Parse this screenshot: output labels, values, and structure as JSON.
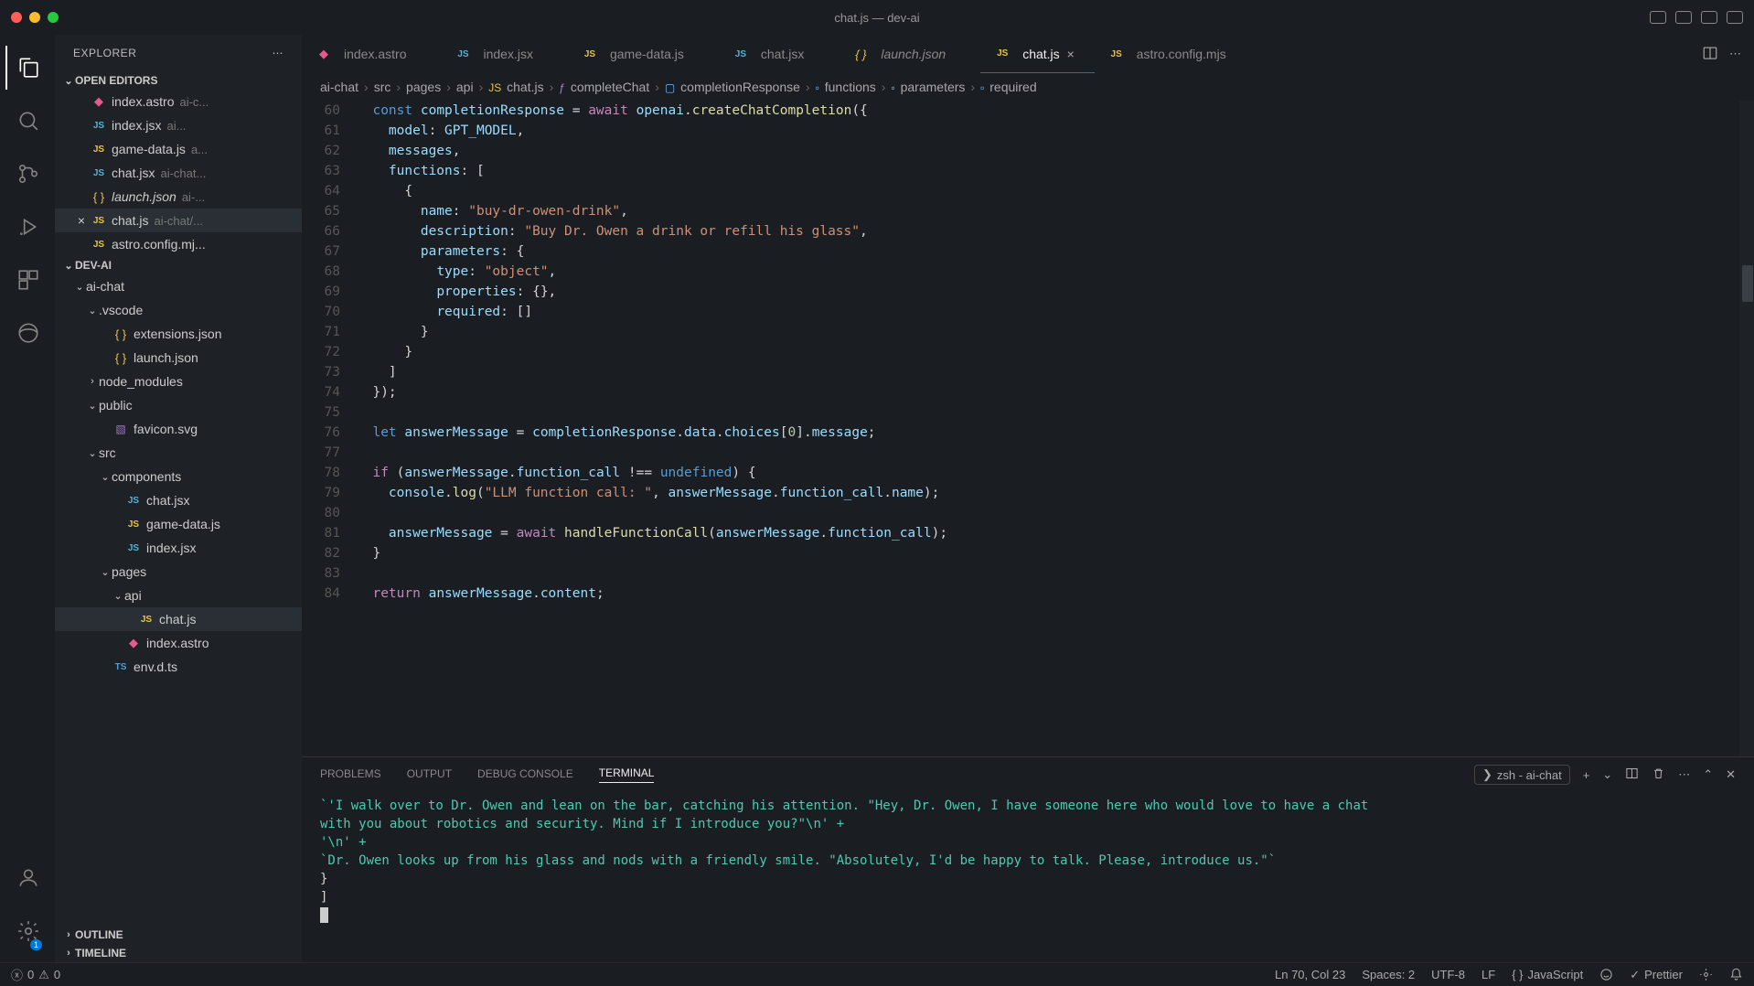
{
  "window": {
    "title": "chat.js — dev-ai"
  },
  "sidebar": {
    "header": "EXPLORER",
    "openEditorsLabel": "OPEN EDITORS",
    "projectLabel": "DEV-AI",
    "outlineLabel": "OUTLINE",
    "timelineLabel": "TIMELINE",
    "editors": [
      {
        "icon": "astro",
        "name": "index.astro",
        "path": "ai-c...",
        "italic": false
      },
      {
        "icon": "jsx",
        "name": "index.jsx",
        "path": "ai...",
        "italic": false
      },
      {
        "icon": "js",
        "name": "game-data.js",
        "path": "a...",
        "italic": false
      },
      {
        "icon": "jsx",
        "name": "chat.jsx",
        "path": "ai-chat...",
        "italic": false
      },
      {
        "icon": "json",
        "name": "launch.json",
        "path": "ai-...",
        "italic": true
      },
      {
        "icon": "js",
        "name": "chat.js",
        "path": "ai-chat/...",
        "italic": false,
        "active": true
      },
      {
        "icon": "js",
        "name": "astro.config.mj...",
        "path": "",
        "italic": false
      }
    ],
    "tree": [
      {
        "depth": 0,
        "type": "folder",
        "open": true,
        "name": "ai-chat"
      },
      {
        "depth": 1,
        "type": "folder",
        "open": true,
        "name": ".vscode"
      },
      {
        "depth": 2,
        "type": "file",
        "icon": "json",
        "name": "extensions.json"
      },
      {
        "depth": 2,
        "type": "file",
        "icon": "json",
        "name": "launch.json"
      },
      {
        "depth": 1,
        "type": "folder",
        "open": false,
        "name": "node_modules"
      },
      {
        "depth": 1,
        "type": "folder",
        "open": true,
        "name": "public"
      },
      {
        "depth": 2,
        "type": "file",
        "icon": "svg",
        "name": "favicon.svg"
      },
      {
        "depth": 1,
        "type": "folder",
        "open": true,
        "name": "src"
      },
      {
        "depth": 2,
        "type": "folder",
        "open": true,
        "name": "components"
      },
      {
        "depth": 3,
        "type": "file",
        "icon": "jsx",
        "name": "chat.jsx"
      },
      {
        "depth": 3,
        "type": "file",
        "icon": "js",
        "name": "game-data.js"
      },
      {
        "depth": 3,
        "type": "file",
        "icon": "jsx",
        "name": "index.jsx"
      },
      {
        "depth": 2,
        "type": "folder",
        "open": true,
        "name": "pages"
      },
      {
        "depth": 3,
        "type": "folder",
        "open": true,
        "name": "api"
      },
      {
        "depth": 4,
        "type": "file",
        "icon": "js",
        "name": "chat.js",
        "active": true
      },
      {
        "depth": 3,
        "type": "file",
        "icon": "astro",
        "name": "index.astro"
      },
      {
        "depth": 2,
        "type": "file",
        "icon": "ts",
        "name": "env.d.ts"
      }
    ]
  },
  "tabs": [
    {
      "icon": "astro",
      "name": "index.astro"
    },
    {
      "icon": "jsx",
      "name": "index.jsx"
    },
    {
      "icon": "js",
      "name": "game-data.js"
    },
    {
      "icon": "jsx",
      "name": "chat.jsx"
    },
    {
      "icon": "json",
      "name": "launch.json",
      "italic": true
    },
    {
      "icon": "js",
      "name": "chat.js",
      "active": true
    },
    {
      "icon": "js",
      "name": "astro.config.mjs"
    }
  ],
  "breadcrumbs": {
    "items": [
      "ai-chat",
      "src",
      "pages",
      "api",
      "chat.js",
      "completeChat",
      "completionResponse",
      "functions",
      "parameters",
      "required"
    ]
  },
  "code": {
    "startLine": 60,
    "lines": [
      {
        "n": 60,
        "html": "  <span class='tok-const'>const</span> <span class='tok-var'>completionResponse</span> <span class='tok-punct'>=</span> <span class='tok-keyword'>await</span> <span class='tok-var'>openai</span><span class='tok-punct'>.</span><span class='tok-func'>createChatCompletion</span><span class='tok-punct'>({</span>"
      },
      {
        "n": 61,
        "html": "    <span class='tok-prop'>model</span><span class='tok-punct'>:</span> <span class='tok-var'>GPT_MODEL</span><span class='tok-punct'>,</span>"
      },
      {
        "n": 62,
        "html": "    <span class='tok-prop'>messages</span><span class='tok-punct'>,</span>"
      },
      {
        "n": 63,
        "html": "    <span class='tok-prop'>functions</span><span class='tok-punct'>: [</span>"
      },
      {
        "n": 64,
        "html": "      <span class='tok-punct'>{</span>"
      },
      {
        "n": 65,
        "html": "        <span class='tok-prop'>name</span><span class='tok-punct'>:</span> <span class='tok-string'>\"buy-dr-owen-drink\"</span><span class='tok-punct'>,</span>"
      },
      {
        "n": 66,
        "html": "        <span class='tok-prop'>description</span><span class='tok-punct'>:</span> <span class='tok-string'>\"Buy Dr. Owen a drink or refill his glass\"</span><span class='tok-punct'>,</span>"
      },
      {
        "n": 67,
        "html": "        <span class='tok-prop'>parameters</span><span class='tok-punct'>: {</span>"
      },
      {
        "n": 68,
        "html": "          <span class='tok-prop'>type</span><span class='tok-punct'>:</span> <span class='tok-string'>\"object\"</span><span class='tok-punct'>,</span>"
      },
      {
        "n": 69,
        "html": "          <span class='tok-prop'>properties</span><span class='tok-punct'>: {},</span>"
      },
      {
        "n": 70,
        "html": "          <span class='tok-prop'>required</span><span class='tok-punct'>: []</span>"
      },
      {
        "n": 71,
        "html": "        <span class='tok-punct'>}</span>"
      },
      {
        "n": 72,
        "html": "      <span class='tok-punct'>}</span>"
      },
      {
        "n": 73,
        "html": "    <span class='tok-punct'>]</span>"
      },
      {
        "n": 74,
        "html": "  <span class='tok-punct'>});</span>"
      },
      {
        "n": 75,
        "html": ""
      },
      {
        "n": 76,
        "html": "  <span class='tok-const'>let</span> <span class='tok-var'>answerMessage</span> <span class='tok-punct'>=</span> <span class='tok-var'>completionResponse</span><span class='tok-punct'>.</span><span class='tok-prop'>data</span><span class='tok-punct'>.</span><span class='tok-prop'>choices</span><span class='tok-punct'>[</span><span class='tok-num'>0</span><span class='tok-punct'>].</span><span class='tok-prop'>message</span><span class='tok-punct'>;</span>"
      },
      {
        "n": 77,
        "html": ""
      },
      {
        "n": 78,
        "html": "  <span class='tok-keyword'>if</span> <span class='tok-punct'>(</span><span class='tok-var'>answerMessage</span><span class='tok-punct'>.</span><span class='tok-prop'>function_call</span> <span class='tok-punct'>!==</span> <span class='tok-const'>undefined</span><span class='tok-punct'>) {</span>"
      },
      {
        "n": 79,
        "html": "    <span class='tok-var'>console</span><span class='tok-punct'>.</span><span class='tok-func'>log</span><span class='tok-punct'>(</span><span class='tok-string'>\"LLM function call: \"</span><span class='tok-punct'>,</span> <span class='tok-var'>answerMessage</span><span class='tok-punct'>.</span><span class='tok-prop'>function_call</span><span class='tok-punct'>.</span><span class='tok-prop'>name</span><span class='tok-punct'>);</span>"
      },
      {
        "n": 80,
        "html": ""
      },
      {
        "n": 81,
        "html": "    <span class='tok-var'>answerMessage</span> <span class='tok-punct'>=</span> <span class='tok-keyword'>await</span> <span class='tok-func'>handleFunctionCall</span><span class='tok-punct'>(</span><span class='tok-var'>answerMessage</span><span class='tok-punct'>.</span><span class='tok-prop'>function_call</span><span class='tok-punct'>);</span>"
      },
      {
        "n": 82,
        "html": "  <span class='tok-punct'>}</span>"
      },
      {
        "n": 83,
        "html": ""
      },
      {
        "n": 84,
        "html": "  <span class='tok-keyword'>return</span> <span class='tok-var'>answerMessage</span><span class='tok-punct'>.</span><span class='tok-prop'>content</span><span class='tok-punct'>;</span>"
      }
    ]
  },
  "panel": {
    "tabs": {
      "problems": "PROBLEMS",
      "output": "OUTPUT",
      "debug": "DEBUG CONSOLE",
      "terminal": "TERMINAL"
    },
    "terminalName": "zsh - ai-chat",
    "terminalLines": [
      "  `'I walk over to Dr. Owen and lean on the bar, catching his attention. \"Hey, Dr. Owen, I have someone here who would love to have a chat",
      "with you about robotics and security. Mind if I introduce you?\"\\n' +",
      "  '\\n' +",
      "  `Dr. Owen looks up from his glass and nods with a friendly smile. \"Absolutely, I'd be happy to talk. Please, introduce us.\"`",
      "  }",
      "]"
    ]
  },
  "status": {
    "errors": "0",
    "warnings": "0",
    "position": "Ln 70, Col 23",
    "spaces": "Spaces: 2",
    "encoding": "UTF-8",
    "eol": "LF",
    "language": "JavaScript",
    "prettier": "Prettier"
  },
  "badge": {
    "settings": "1"
  }
}
